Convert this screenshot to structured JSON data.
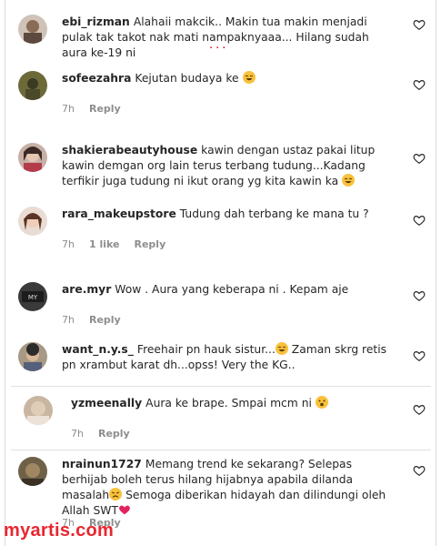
{
  "comments": [
    {
      "username": "ebi_rizman",
      "text": "Alahaii makcik.. Makin tua makin menjadi pulak tak takot nak mati nampaknyaaa... Hilang sudah aura ke-19 ni",
      "time": "",
      "likes": "",
      "reply": ""
    },
    {
      "username": "sofeezahra",
      "text": "Kejutan budaya ke",
      "time": "7h",
      "likes": "",
      "reply": "Reply"
    },
    {
      "username": "shakierabeautyhouse",
      "text": "kawin dengan ustaz pakai litup kawin demgan org lain terus terbang tudung...Kadang terfikir juga tudung ni ikut orang yg kita kawin ka",
      "time": "",
      "likes": "",
      "reply": ""
    },
    {
      "username": "rara_makeupstore",
      "text": "Tudung dah terbang ke mana tu ?",
      "time": "7h",
      "likes": "1 like",
      "reply": "Reply"
    },
    {
      "username": "are.myr",
      "text": "Wow . Aura yang keberapa ni . Kepam aje",
      "time": "7h",
      "likes": "",
      "reply": "Reply"
    },
    {
      "username": "want_n.y.s_",
      "text": "Freehair pn hauk sistur...",
      "text2": " Zaman skrg retis pn xrambut karat dh...opss! Very the KG..",
      "time": "",
      "likes": "",
      "reply": ""
    },
    {
      "username": "yzmeenally",
      "text": "Aura ke brape. Smpai mcm ni",
      "time": "7h",
      "likes": "",
      "reply": "Reply"
    },
    {
      "username": "nrainun1727",
      "text": "Memang trend ke sekarang? Selepas berhijab boleh terus hilang hijabnya apabila dilanda masalah",
      "text2": " Semoga diberikan hidayah dan dilindungi oleh Allah SWT",
      "time": "7h",
      "likes": "",
      "reply": "Reply"
    }
  ],
  "watermark": "myartis.com",
  "colors": {
    "muted": "#8e8e8e",
    "text": "#262626",
    "watermark": "#e8262f"
  }
}
